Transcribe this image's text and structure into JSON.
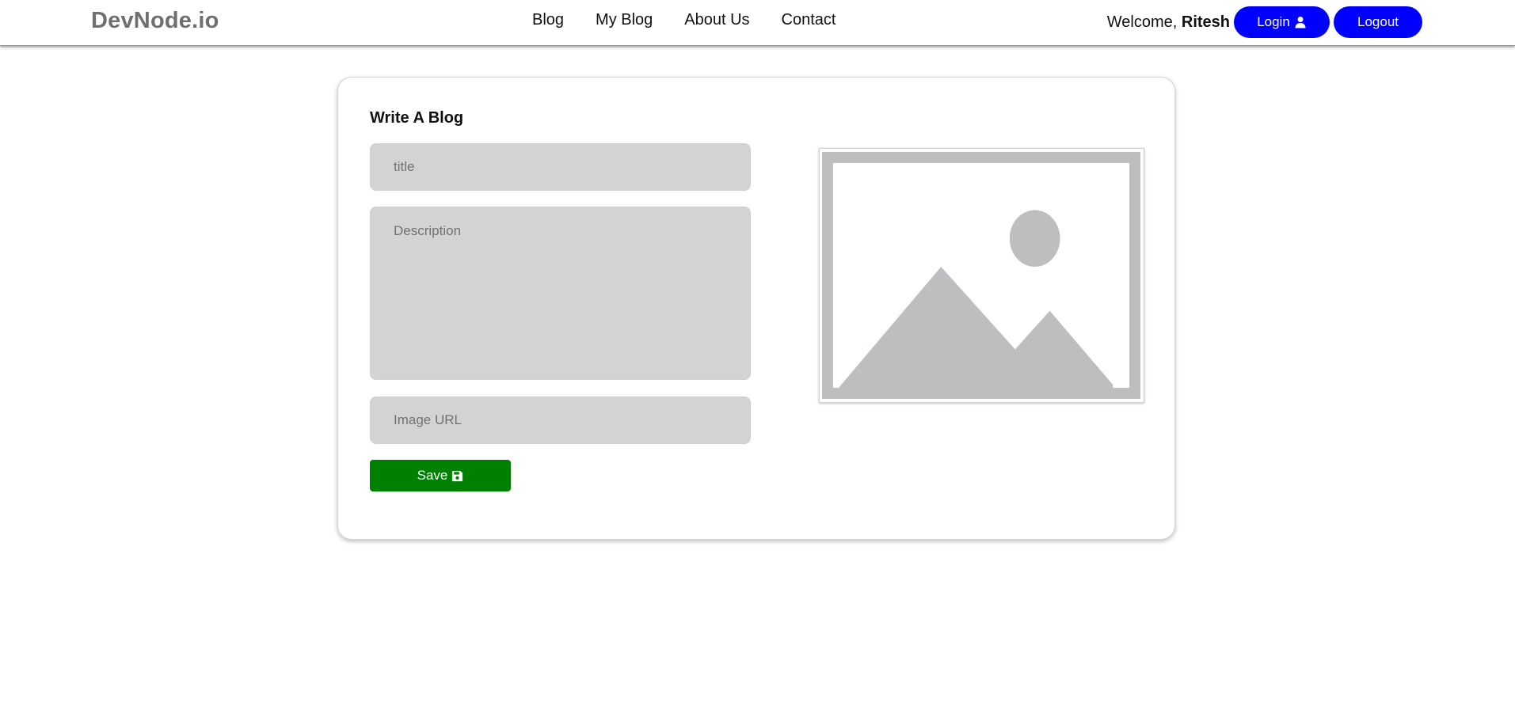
{
  "brand": "DevNode.io",
  "nav": {
    "links": [
      "Blog",
      "My Blog",
      "About Us",
      "Contact"
    ]
  },
  "user": {
    "welcome_prefix": "Welcome,",
    "name": "Ritesh",
    "login_label": "Login",
    "logout_label": "Logout",
    "login_icon": "user-icon"
  },
  "form": {
    "heading": "Write A Blog",
    "title_placeholder": "title",
    "description_placeholder": "Description",
    "image_url_placeholder": "Image URL",
    "save_label": "Save",
    "save_icon": "floppy-disk-icon"
  },
  "preview": {
    "icon": "image-placeholder-icon"
  },
  "colors": {
    "brand_text": "#6f6f6f",
    "pill_blue": "#0000ff",
    "save_green": "#008000",
    "field_bg": "#d4d3d4",
    "placeholder_gray": "#bdbebf"
  }
}
